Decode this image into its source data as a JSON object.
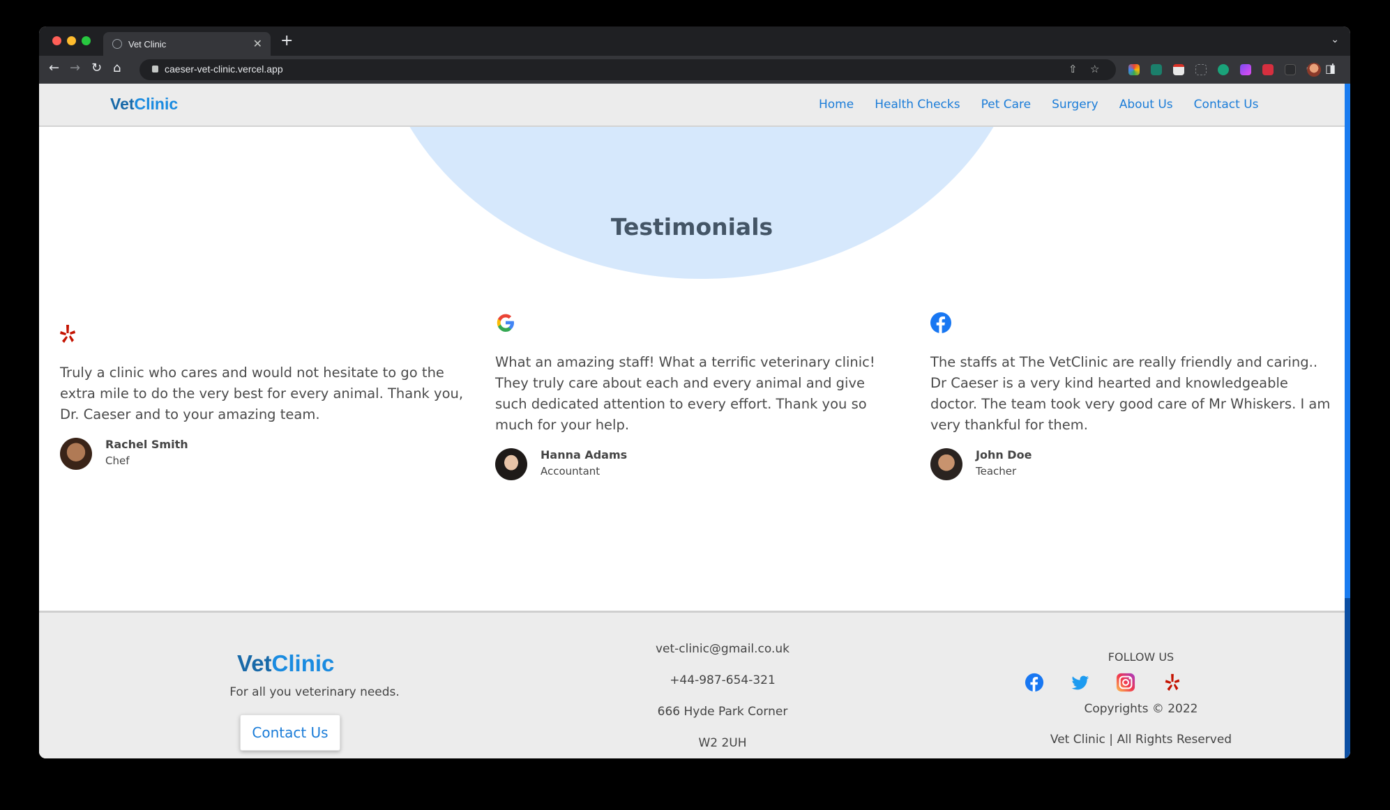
{
  "browser": {
    "tab_title": "Vet Clinic",
    "url": "caeser-vet-clinic.vercel.app"
  },
  "header": {
    "logo_part1": "Vet",
    "logo_part2": "Clinic",
    "nav": [
      "Home",
      "Health Checks",
      "Pet Care",
      "Surgery",
      "About Us",
      "Contact Us"
    ]
  },
  "testimonials": {
    "title": "Testimonials",
    "items": [
      {
        "source_icon": "yelp-icon",
        "text": "Truly a clinic who cares and would not hesitate to go the extra mile to do the very best for every animal. Thank you, Dr. Caeser and to your amazing team.",
        "name": "Rachel Smith",
        "role": "Chef"
      },
      {
        "source_icon": "google-icon",
        "text": "What an amazing staff! What a terrific veterinary clinic! They truly care about each and every animal and give such dedicated attention to every effort. Thank you so much for your help.",
        "name": "Hanna Adams",
        "role": "Accountant"
      },
      {
        "source_icon": "facebook-icon",
        "text": "The staffs at The VetClinic are really friendly and caring.. Dr Caeser is a very kind hearted and knowledgeable doctor. The team took very good care of Mr Whiskers. I am very thankful for them.",
        "name": "John Doe",
        "role": "Teacher"
      }
    ]
  },
  "footer": {
    "logo_part1": "Vet",
    "logo_part2": "Clinic",
    "tagline": "For all you veterinary needs.",
    "contact_button": "Contact Us",
    "email": "vet-clinic@gmail.co.uk",
    "phone": "+44-987-654-321",
    "address_line1": "666 Hyde Park Corner",
    "address_line2": "W2 2UH",
    "follow_label": "FOLLOW US",
    "copyright": "Copyrights © 2022",
    "rights": "Vet Clinic | All Rights Reserved"
  },
  "colors": {
    "brand_dark": "#1869a8",
    "brand_light": "#1a8be0",
    "link": "#1a7cd8",
    "blob": "#d6e8fc"
  }
}
